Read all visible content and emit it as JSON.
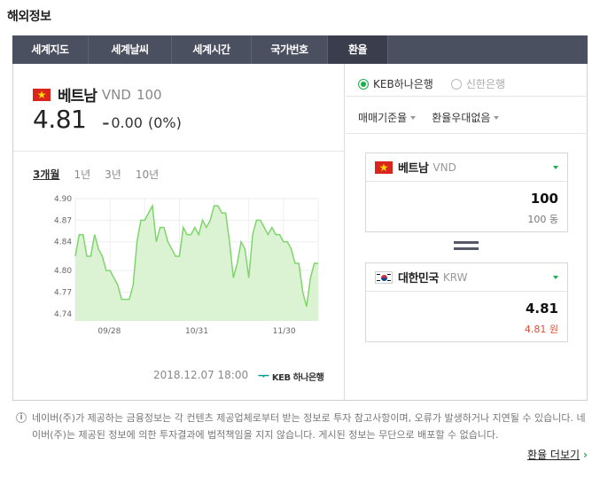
{
  "section_title": "해외정보",
  "tabs": [
    {
      "label": "세계지도"
    },
    {
      "label": "세계날씨"
    },
    {
      "label": "세계시간"
    },
    {
      "label": "국가번호"
    },
    {
      "label": "환율"
    }
  ],
  "currency": {
    "name": "베트남",
    "code": "VND",
    "unit": "100",
    "rate": "4.81",
    "change_arrow": "–",
    "change": "0.00",
    "change_pct": "(0%)"
  },
  "periods": [
    {
      "label": "3개월"
    },
    {
      "label": "1년"
    },
    {
      "label": "3년"
    },
    {
      "label": "10년"
    }
  ],
  "chart_data": {
    "type": "area",
    "x": [
      "09/28",
      "10/31",
      "11/30"
    ],
    "ylim": [
      4.73,
      4.9
    ],
    "yticks": [
      "4.90",
      "4.87",
      "4.84",
      "4.80",
      "4.77",
      "4.74"
    ],
    "values": [
      4.82,
      4.85,
      4.85,
      4.82,
      4.82,
      4.85,
      4.83,
      4.82,
      4.8,
      4.8,
      4.79,
      4.78,
      4.76,
      4.76,
      4.76,
      4.78,
      4.84,
      4.87,
      4.87,
      4.88,
      4.89,
      4.84,
      4.86,
      4.86,
      4.84,
      4.83,
      4.82,
      4.82,
      4.86,
      4.85,
      4.85,
      4.86,
      4.85,
      4.87,
      4.86,
      4.87,
      4.89,
      4.89,
      4.88,
      4.88,
      4.84,
      4.79,
      4.81,
      4.84,
      4.83,
      4.79,
      4.85,
      4.87,
      4.87,
      4.86,
      4.85,
      4.86,
      4.85,
      4.85,
      4.84,
      4.84,
      4.83,
      4.81,
      4.81,
      4.77,
      4.75,
      4.79,
      4.81,
      4.81
    ],
    "grid": true,
    "colors": {
      "line": "#7ed66b",
      "fill": "#dbf3d3"
    }
  },
  "footer": {
    "date": "2018.12.07 18:00",
    "bank_mark": "ᅮ",
    "bank_text": "KEB 하나은행"
  },
  "banks": [
    {
      "label": "KEB하나은행",
      "selected": true
    },
    {
      "label": "신한은행",
      "selected": false
    }
  ],
  "selects": [
    {
      "label": "매매기준율"
    },
    {
      "label": "환율우대없음"
    }
  ],
  "converter": {
    "from": {
      "name": "베트남",
      "code": "VND",
      "value": "100",
      "sub": "100 동"
    },
    "to": {
      "name": "대한민국",
      "code": "KRW",
      "value": "4.81",
      "sub": "4.81 원"
    }
  },
  "notice_text": "네이버(주)가 제공하는 금융정보는 각 컨텐츠 제공업체로부터 받는 정보로 투자 참고사항이며, 오류가 발생하거나 지연될 수 있습니다. 네이버(주)는 제공된 정보에 의한 투자결과에 법적책임을 지지 않습니다. 게시된 정보는 무단으로 배포할 수 없습니다.",
  "notice_icon": "i",
  "more_link": "환율 더보기",
  "more_chev": "›"
}
